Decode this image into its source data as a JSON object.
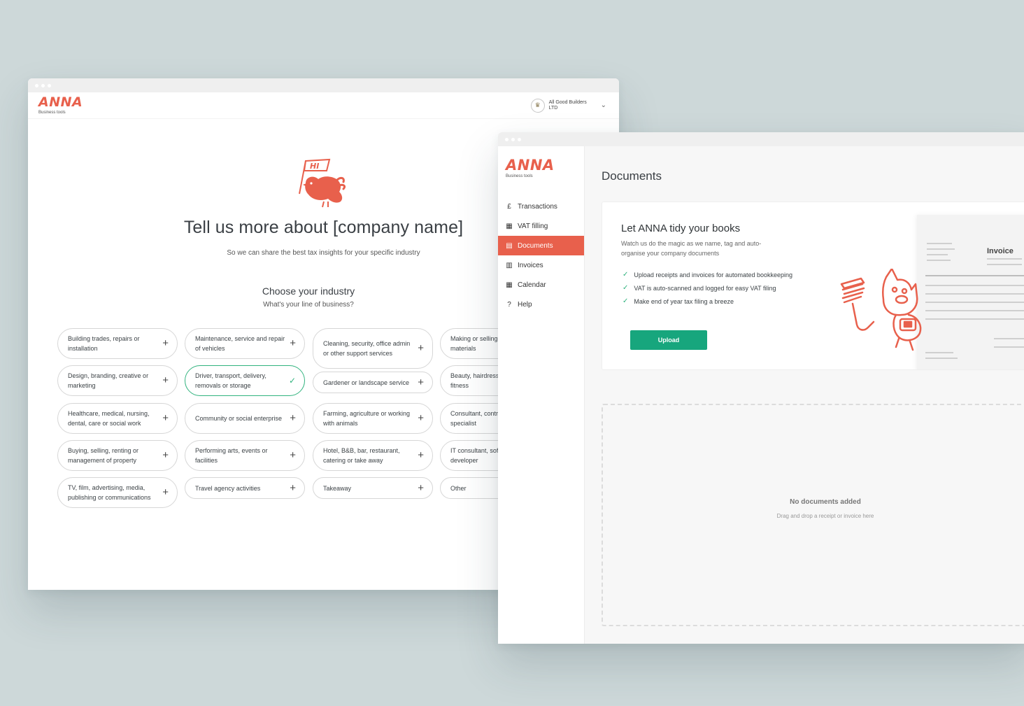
{
  "onboarding": {
    "logo": {
      "word": "ANNA",
      "sub": "Business tools"
    },
    "company": {
      "name": "All Good Builders LTD"
    },
    "bird_flag_text": "HI",
    "title": "Tell us more about [company name]",
    "subtitle": "So we can share the best tax insights for your specific industry",
    "industry_heading": "Choose your industry",
    "industry_question": "What's your line of business?",
    "industries": [
      [
        "Building trades, repairs or installation",
        "Design, branding, creative or marketing",
        "Healthcare, medical, nursing, dental, care or social work",
        "Buying, selling, renting or management of property",
        "TV, film, advertising, media, publishing or communications"
      ],
      [
        "Maintenance, service and repair of vehicles",
        "Driver, transport, delivery, removals or storage",
        "Community or social enterprise",
        "Performing arts, events or facilities",
        "Travel agency activities"
      ],
      [
        "Cleaning, security, office admin  or other support services",
        "Gardener or landscape service",
        "Farming, agriculture or working with animals",
        "Hotel, B&B, bar, restaurant, catering or take away",
        "Takeaway"
      ],
      [
        "Making or selling goods or materials",
        "Beauty, hairdresser, sports or fitness",
        "Consultant, contractor or specialist",
        "IT consultant, software developer",
        "Other"
      ]
    ],
    "selected_industry": "Driver, transport, delivery, removals or storage"
  },
  "documents": {
    "logo": {
      "word": "ANNA",
      "sub": "Business tools"
    },
    "nav": [
      {
        "label": "Transactions",
        "icon": "receipt-icon"
      },
      {
        "label": "VAT filling",
        "icon": "calculator-icon"
      },
      {
        "label": "Documents",
        "icon": "document-icon",
        "active": true
      },
      {
        "label": "Invoices",
        "icon": "invoice-icon"
      },
      {
        "label": "Calendar",
        "icon": "calendar-icon"
      },
      {
        "label": "Help",
        "icon": "help-icon"
      }
    ],
    "page_title": "Documents",
    "card": {
      "title": "Let ANNA tidy your books",
      "description": "Watch us do the magic as we name, tag and auto-organise your company documents",
      "checks": [
        "Upload receipts and invoices for automated bookkeeping",
        "VAT is auto-scanned and logged for easy VAT filing",
        "Make end of year tax filing a breeze"
      ],
      "upload_label": "Upload",
      "invoice_label": "Invoice"
    },
    "dropzone": {
      "title": "No documents added",
      "hint": "Drag and drop a receipt or invoice here"
    }
  },
  "colors": {
    "brand": "#e8604c",
    "success": "#17a67d",
    "selected_border": "#31b37e"
  }
}
